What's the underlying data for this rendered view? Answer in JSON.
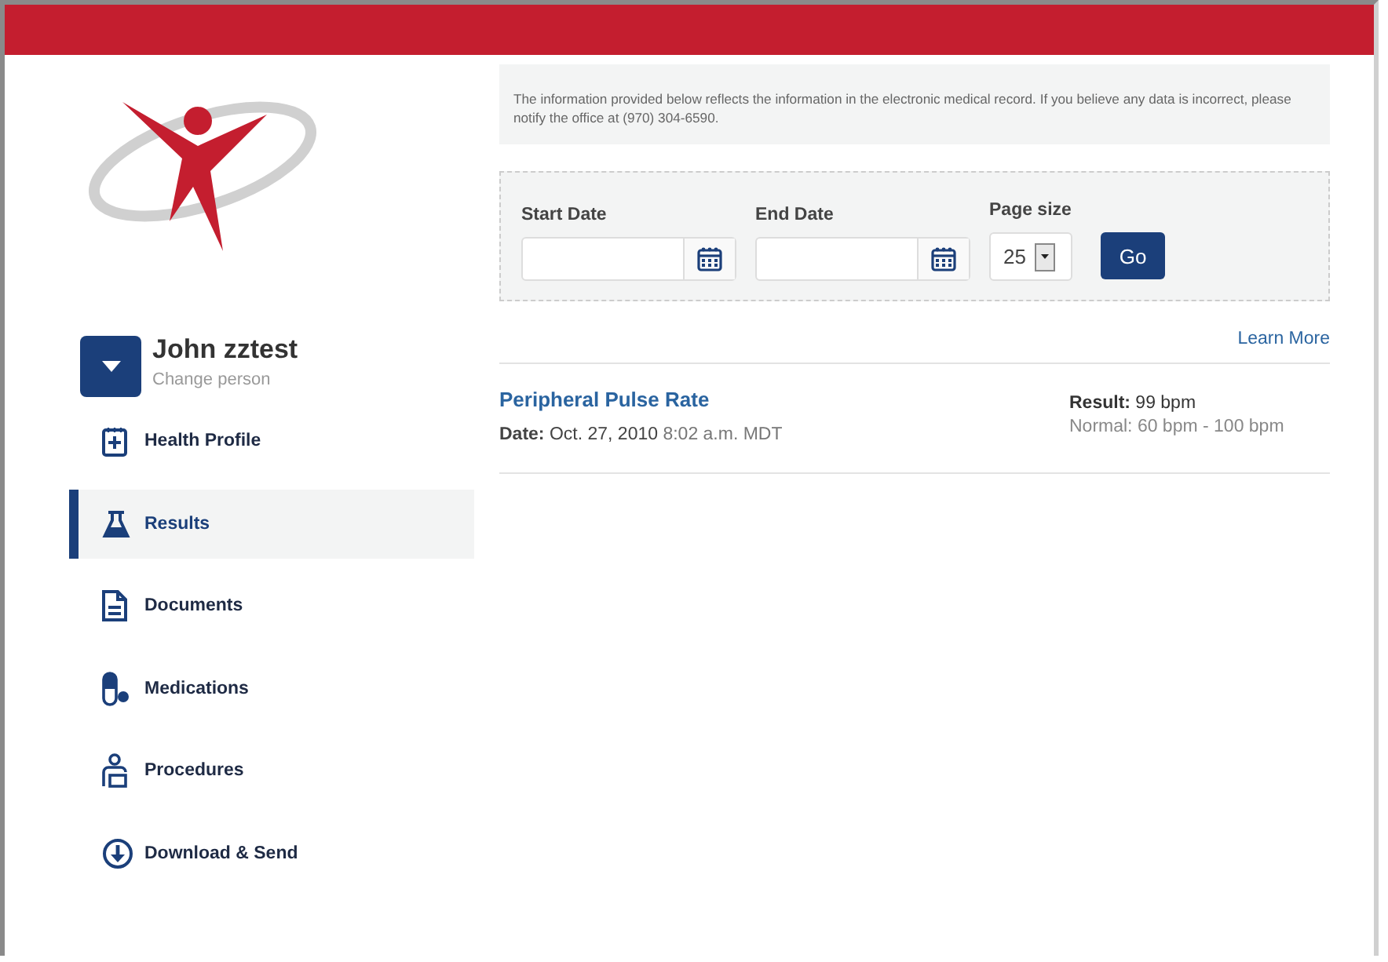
{
  "person": {
    "name": "John zztest",
    "action": "Change person"
  },
  "nav": [
    {
      "label": "Health Profile",
      "selected": false
    },
    {
      "label": "Results",
      "selected": true
    },
    {
      "label": "Documents",
      "selected": false
    },
    {
      "label": "Medications",
      "selected": false
    },
    {
      "label": "Procedures",
      "selected": false
    },
    {
      "label": "Download & Send",
      "selected": false
    }
  ],
  "notice": "The information provided below reflects the information in the electronic medical record. If you believe any data is incorrect, please notify the office at (970) 304-6590.",
  "filters": {
    "start_label": "Start Date",
    "end_label": "End Date",
    "page_size_label": "Page size",
    "page_size": "25",
    "go": "Go"
  },
  "learn_more": "Learn More",
  "results": [
    {
      "title": "Peripheral Pulse Rate",
      "date_label": "Date:",
      "date": "Oct. 27, 2010",
      "time": "8:02 a.m. MDT",
      "result_label": "Result:",
      "result": "99 bpm",
      "normal": "Normal: 60 bpm - 100 bpm"
    }
  ]
}
